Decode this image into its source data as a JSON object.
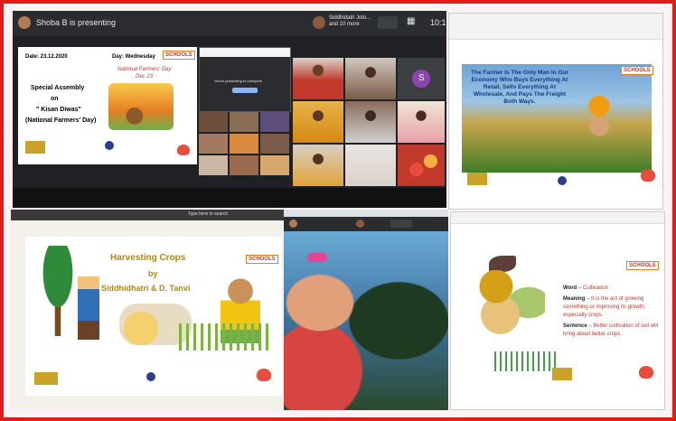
{
  "meet": {
    "presenter_text": "Shoba B is presenting",
    "participants_text": "Siddhidatri Jolo... and 10 more",
    "clock": "10:1",
    "presenting_msg": "You're presenting to everyone",
    "participant_initial": "S"
  },
  "slide1": {
    "date": "Date: 23.12.2020",
    "day": "Day: Wednesday",
    "line1": "Special Assembly",
    "line2": "on",
    "line3": "\" Kisan Diwas\"",
    "line4": "(National Farmers' Day)",
    "banner1": "National Farmers' Day",
    "banner2": "Dec 23"
  },
  "slide2": {
    "quote": "The Farmer Is The Only Man In Our Economy Who Buys Everything At Retail, Sells Everything At Wholesale, And Pays The Freight Both Ways."
  },
  "slide3": {
    "title": "Harvesting Crops",
    "by": "by",
    "authors": "Siddhidhatri & D. Tanvi",
    "search": "Type here to search"
  },
  "slide4": {
    "word_label": "Word",
    "word_value": " – Cultivation",
    "meaning_label": "Meaning",
    "meaning_value": " – It is the act of growing something or improving its growth, especially crops.",
    "sentence_label": "Sentence",
    "sentence_value": " – Better cultivation of soil will bring about better crops."
  },
  "common": {
    "schools_badge": "SCHOOLS"
  },
  "colors": {
    "frame": "#e21b1b",
    "meet_bg": "#202124",
    "accent": "#1a73e8"
  }
}
